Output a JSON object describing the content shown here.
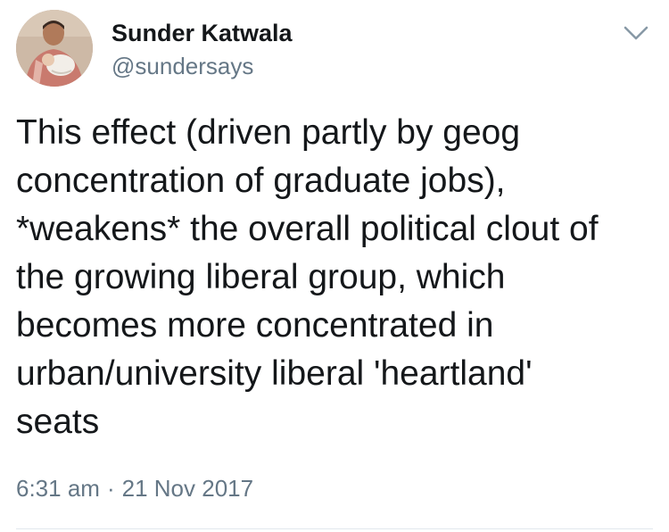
{
  "author": {
    "name": "Sunder Katwala",
    "handle": "@sundersays"
  },
  "tweet": {
    "text": "This effect (driven partly by geog\nconcentration of graduate jobs),\n*weakens* the overall political clout of\nthe growing liberal group, which\nbecomes more concentrated in\nurban/university liberal 'heartland'\nseats",
    "time": "6:31 am",
    "separator": "·",
    "date": "21 Nov 2017"
  },
  "icons": {
    "menu": "chevron-down-icon",
    "avatar": "profile-photo"
  },
  "colors": {
    "text": "#14171a",
    "secondary": "#657786",
    "divider": "#e1e8ed"
  }
}
